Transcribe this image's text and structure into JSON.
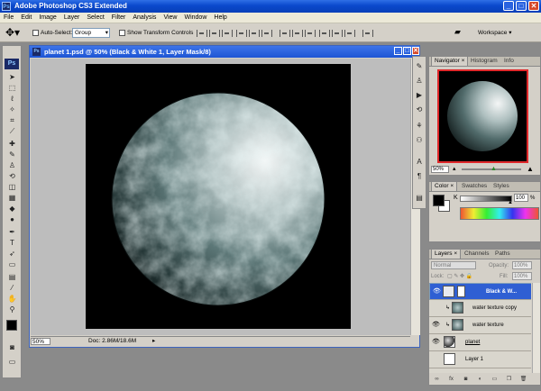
{
  "app": {
    "title": "Adobe Photoshop CS3 Extended",
    "logo": "Ps"
  },
  "window_controls": {
    "minimize": "_",
    "maximize": "□",
    "close": "✕"
  },
  "menu": [
    "File",
    "Edit",
    "Image",
    "Layer",
    "Select",
    "Filter",
    "Analysis",
    "View",
    "Window",
    "Help"
  ],
  "options_bar": {
    "auto_select_label": "Auto-Select:",
    "auto_select_value": "Group",
    "show_transform_label": "Show Transform Controls",
    "workspace_label": "Workspace ▾"
  },
  "document": {
    "title": "planet 1.psd @ 50% (Black & White 1, Layer Mask/8)",
    "zoom": "50%",
    "doc_info": "Doc: 2.86M/18.6M"
  },
  "navigator": {
    "tabs": [
      "Navigator ×",
      "Histogram",
      "Info"
    ],
    "zoom": "50%"
  },
  "color_panel": {
    "tabs": [
      "Color ×",
      "Swatches",
      "Styles"
    ],
    "channel": "K",
    "value": "100",
    "unit": "%"
  },
  "layers_panel": {
    "tabs": [
      "Layers ×",
      "Channels",
      "Paths"
    ],
    "blend_mode": "Normal",
    "opacity_label": "Opacity:",
    "opacity": "100%",
    "lock_label": "Lock:",
    "fill_label": "Fill:",
    "fill": "100%",
    "layers": [
      {
        "name": "Black & W...",
        "selected": true
      },
      {
        "name": "water texture copy",
        "selected": false
      },
      {
        "name": "water texture",
        "selected": false
      },
      {
        "name": "planet",
        "selected": false
      },
      {
        "name": "Layer 1",
        "selected": false
      }
    ]
  },
  "colors": {
    "titlebar": "#0a48cc",
    "selection": "#2f5fd3",
    "nav_frame": "#e0282a",
    "foreground": "#000000",
    "background": "#ffffff"
  }
}
